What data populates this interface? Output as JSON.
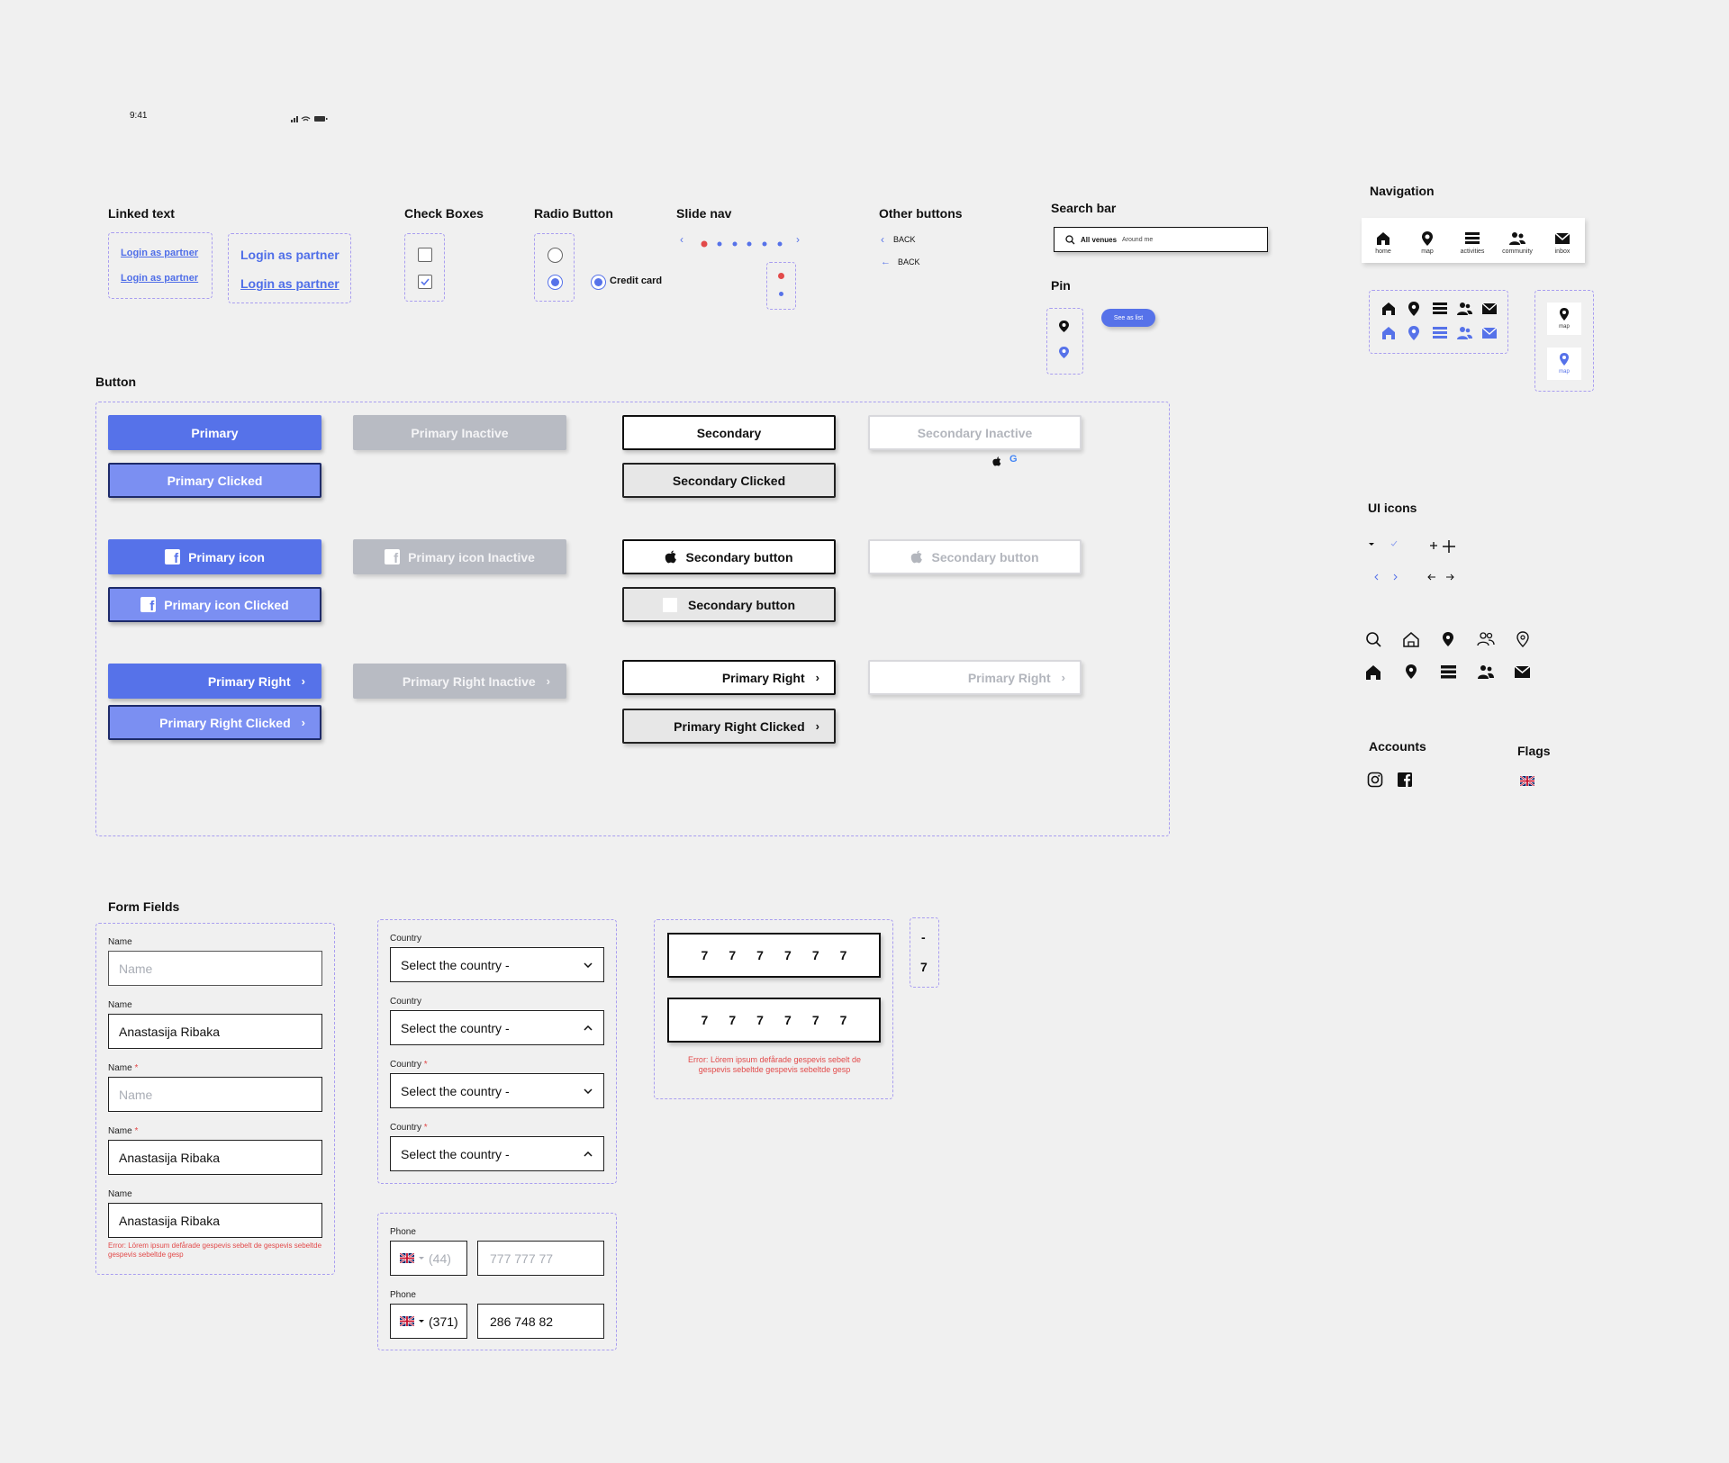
{
  "status_bar": {
    "time": "9:41"
  },
  "sections": {
    "linked_text": "Linked text",
    "check_boxes": "Check Boxes",
    "radio_button": "Radio Button",
    "slide_nav": "Slide nav",
    "other_buttons": "Other buttons",
    "search_bar": "Search bar",
    "pin": "Pin",
    "navigation": "Navigation",
    "button": "Button",
    "ui_icons": "UI icons",
    "accounts": "Accounts",
    "flags": "Flags",
    "form_fields": "Form Fields"
  },
  "linked_text": {
    "small": "Login as partner",
    "large": "Login as partner"
  },
  "radio": {
    "credit_card": "Credit card"
  },
  "other_buttons": {
    "back": "BACK"
  },
  "search": {
    "tab_all": "All venues",
    "tab_around": "Around me"
  },
  "pin": {
    "see_as_list": "See as list"
  },
  "navigation": {
    "items": [
      "home",
      "map",
      "activities",
      "community",
      "inbox"
    ],
    "map": "map"
  },
  "buttons": {
    "primary": "Primary",
    "primary_clicked": "Primary Clicked",
    "primary_inactive": "Primary Inactive",
    "secondary": "Secondary",
    "secondary_clicked": "Secondary Clicked",
    "secondary_inactive": "Secondary Inactive",
    "primary_icon": "Primary icon",
    "primary_icon_clicked": "Primary icon Clicked",
    "primary_icon_inactive": "Primary icon Inactive",
    "secondary_button": "Secondary button",
    "primary_right": "Primary Right",
    "primary_right_clicked": "Primary Right Clicked",
    "primary_right_inactive": "Primary Right Inactive"
  },
  "form": {
    "name_label": "Name",
    "name_placeholder": "Name",
    "name_value": "Anastasija Ribaka",
    "required": "*",
    "error": "Error: Lörem ipsum defårade gespevis sebelt de gespevis sebeltde gespevis sebeltde gesp",
    "country_label": "Country",
    "country_value": "Select the country -",
    "phone_label": "Phone",
    "phone_code_empty": "(44)",
    "phone_placeholder": "777 777 77",
    "phone_code": "(371)",
    "phone_value": "286 748 82",
    "otp_digits": [
      "7",
      "7",
      "7",
      "7",
      "7",
      "7"
    ],
    "otp_minus": "-",
    "otp_single": "7"
  },
  "colors": {
    "accent": "#5672e9",
    "dashed": "#a99ef0",
    "error": "#e24a4a",
    "background": "#f0f0f0"
  }
}
